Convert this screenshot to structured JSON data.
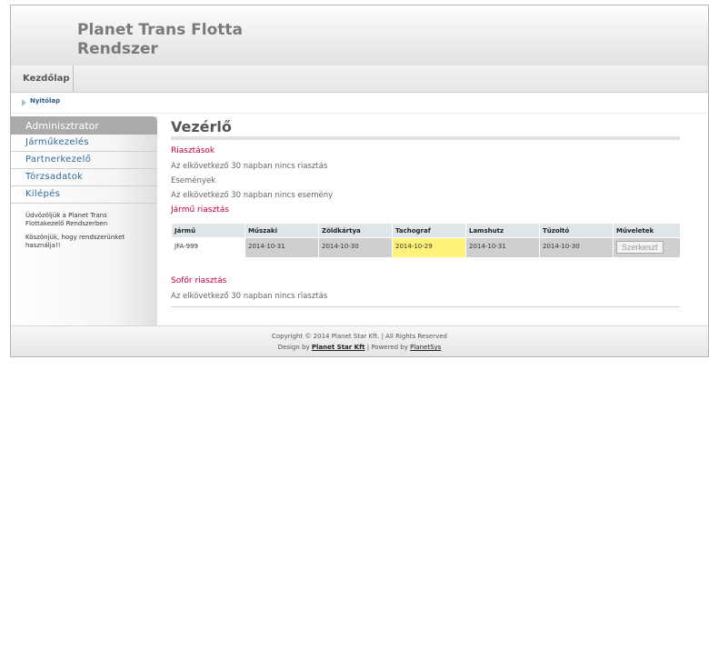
{
  "site": {
    "title_line1": "Planet Trans Flotta",
    "title_line2": "Rendszer"
  },
  "topnav": {
    "home": "Kezdőlap"
  },
  "breadcrumb": {
    "current": "Nyitólap"
  },
  "sidebar": {
    "heading": "Adminisztrator",
    "items": [
      {
        "label": "Járműkezelés"
      },
      {
        "label": "Partnerkezelő"
      },
      {
        "label": "Törzsadatok"
      },
      {
        "label": "Kilépés"
      }
    ],
    "welcome": "Üdvözöljük a Planet Trans Flottakezelő Rendszerben",
    "thanks": "Köszönjük, hogy rendszerünket használja!!"
  },
  "main": {
    "title": "Vezérlő",
    "alerts_heading": "Riasztások",
    "alerts_text": "Az elkövetkező 30 napban nincs riasztás",
    "events_heading": "Események",
    "events_text": "Az elkövetkező 30 napban nincs esemény",
    "vehicle_heading": "Jármű riasztás",
    "table": {
      "headers": [
        "Jármű",
        "Műszaki",
        "Zöldkártya",
        "Tachograf",
        "Lamshutz",
        "Tűzoltó",
        "Műveletek"
      ],
      "rows": [
        {
          "vehicle": "JFA-999",
          "muszaki": "2014-10-31",
          "zoldkartya": "2014-10-30",
          "tachograf": "2014-10-29",
          "lamshutz": "2014-10-31",
          "tuzolto": "2014-10-30",
          "action": "Szerkeszt"
        }
      ]
    },
    "driver_heading": "Sofőr riasztás",
    "driver_text": "Az elkövetkező 30 napban nincs riasztás"
  },
  "footer": {
    "copyright": "Copyright © 2014 Planet Star Kft.  |  All Rights Reserved",
    "design_by": "Design by",
    "design_link": "Planet Star Kft",
    "powered_by": "| Powered by",
    "powered_link": "PlanetSys"
  },
  "colors": {
    "alert_red": "#c0003c",
    "highlight_yellow": "#fff27a",
    "link_blue": "#2f6a9e"
  }
}
